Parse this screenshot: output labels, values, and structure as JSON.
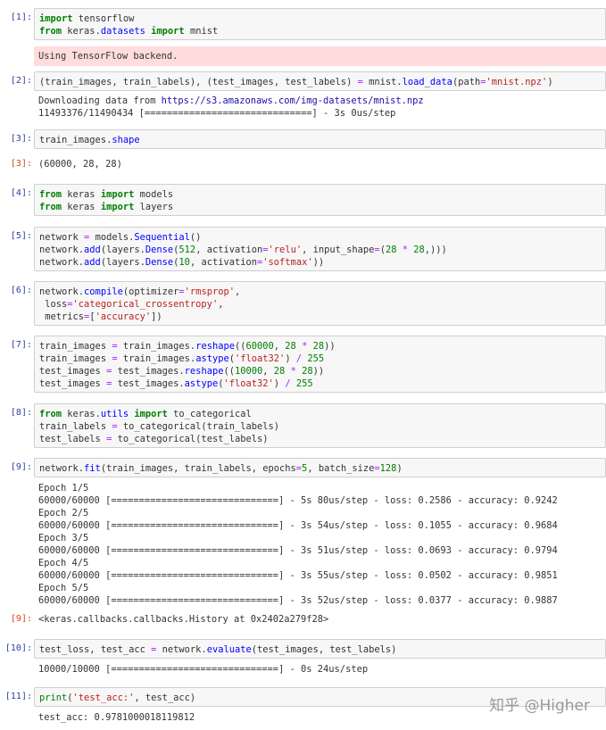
{
  "cells": [
    {
      "prompt": "[1]:",
      "input": [
        "import tensorflow",
        "from keras.datasets import mnist"
      ],
      "stderr": [
        "Using TensorFlow backend."
      ]
    },
    {
      "prompt": "[2]:",
      "input": [
        "(train_images, train_labels), (test_images, test_labels) = mnist.load_data(path='mnist.npz')"
      ],
      "stream": [
        "Downloading data from https://s3.amazonaws.com/img-datasets/mnist.npz",
        "11493376/11490434 [==============================] - 3s 0us/step"
      ]
    },
    {
      "prompt": "[3]:",
      "input": [
        "train_images.shape"
      ],
      "out_prompt": "[3]:",
      "output": [
        "(60000, 28, 28)"
      ]
    },
    {
      "prompt": "[4]:",
      "input": [
        "from keras import models",
        "from keras import layers"
      ]
    },
    {
      "prompt": "[5]:",
      "input": [
        "network = models.Sequential()",
        "network.add(layers.Dense(512, activation='relu', input_shape=(28 * 28,)))",
        "network.add(layers.Dense(10, activation='softmax'))"
      ]
    },
    {
      "prompt": "[6]:",
      "input": [
        "network.compile(optimizer='rmsprop',",
        " loss='categorical_crossentropy',",
        " metrics=['accuracy'])"
      ]
    },
    {
      "prompt": "[7]:",
      "input": [
        "train_images = train_images.reshape((60000, 28 * 28))",
        "train_images = train_images.astype('float32') / 255",
        "test_images = test_images.reshape((10000, 28 * 28))",
        "test_images = test_images.astype('float32') / 255"
      ]
    },
    {
      "prompt": "[8]:",
      "input": [
        "from keras.utils import to_categorical",
        "train_labels = to_categorical(train_labels)",
        "test_labels = to_categorical(test_labels)"
      ]
    },
    {
      "prompt": "[9]:",
      "input": [
        "network.fit(train_images, train_labels, epochs=5, batch_size=128)"
      ],
      "stream": [
        "Epoch 1/5",
        "60000/60000 [==============================] - 5s 80us/step - loss: 0.2586 - accuracy: 0.9242",
        "Epoch 2/5",
        "60000/60000 [==============================] - 3s 54us/step - loss: 0.1055 - accuracy: 0.9684",
        "Epoch 3/5",
        "60000/60000 [==============================] - 3s 51us/step - loss: 0.0693 - accuracy: 0.9794",
        "Epoch 4/5",
        "60000/60000 [==============================] - 3s 55us/step - loss: 0.0502 - accuracy: 0.9851",
        "Epoch 5/5",
        "60000/60000 [==============================] - 3s 52us/step - loss: 0.0377 - accuracy: 0.9887"
      ],
      "out_prompt": "[9]:",
      "output": [
        "<keras.callbacks.callbacks.History at 0x2402a279f28>"
      ]
    },
    {
      "prompt": "[10]:",
      "input": [
        "test_loss, test_acc = network.evaluate(test_images, test_labels)"
      ],
      "stream": [
        "10000/10000 [==============================] - 0s 24us/step"
      ]
    },
    {
      "prompt": "[11]:",
      "input": [
        "print('test_acc:', test_acc)"
      ],
      "stream": [
        "test_acc: 0.9781000018119812"
      ]
    }
  ],
  "watermark": "知乎 @Higher"
}
